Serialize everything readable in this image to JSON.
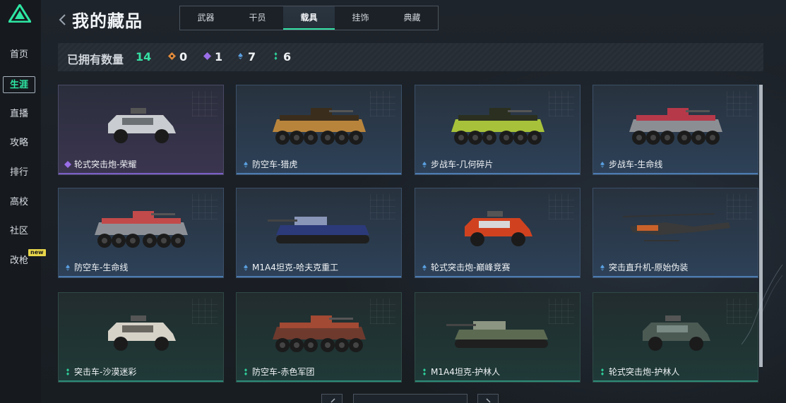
{
  "colors": {
    "accent": "#35e0a4",
    "rarity_orange": "#e08a3a",
    "rarity_purple": "#9a6ee8",
    "rarity_blue": "#5a9fe0",
    "rarity_green": "#2ecf9a"
  },
  "sidebar": {
    "items": [
      {
        "label": "首页"
      },
      {
        "label": "生涯",
        "active": true
      },
      {
        "label": "直播"
      },
      {
        "label": "攻略"
      },
      {
        "label": "排行"
      },
      {
        "label": "高校"
      },
      {
        "label": "社区"
      },
      {
        "label": "改枪",
        "badge": "new"
      }
    ]
  },
  "header": {
    "title": "我的藏品",
    "tabs": [
      {
        "label": "武器"
      },
      {
        "label": "干员"
      },
      {
        "label": "载具",
        "active": true
      },
      {
        "label": "挂饰"
      },
      {
        "label": "典藏"
      }
    ]
  },
  "stats": {
    "owned_label": "已拥有数量",
    "owned_total": "14",
    "rarity_counts": [
      {
        "icon": "orange-diamond-icon",
        "count": "0"
      },
      {
        "icon": "purple-diamond-icon",
        "count": "1"
      },
      {
        "icon": "blue-diamond-icon",
        "count": "7"
      },
      {
        "icon": "green-diamond-icon",
        "count": "6"
      }
    ]
  },
  "items": [
    {
      "name": "轮式突击炮-荣耀",
      "rarity": "purple",
      "icon": "armored-car-icon"
    },
    {
      "name": "防空车-猎虎",
      "rarity": "blue",
      "icon": "apc-icon"
    },
    {
      "name": "步战车-几何碎片",
      "rarity": "blue",
      "icon": "apc-icon"
    },
    {
      "name": "步战车-生命线",
      "rarity": "blue",
      "icon": "apc-icon"
    },
    {
      "name": "防空车-生命线",
      "rarity": "blue",
      "icon": "apc-icon"
    },
    {
      "name": "M1A4坦克-哈夫克重工",
      "rarity": "blue",
      "icon": "tank-icon"
    },
    {
      "name": "轮式突击炮-巅峰竞赛",
      "rarity": "blue",
      "icon": "armored-car-icon"
    },
    {
      "name": "突击直升机-原始伪装",
      "rarity": "blue",
      "icon": "helicopter-icon"
    },
    {
      "name": "突击车-沙漠迷彩",
      "rarity": "green",
      "icon": "armored-car-icon"
    },
    {
      "name": "防空车-赤色军团",
      "rarity": "green",
      "icon": "apc-icon"
    },
    {
      "name": "M1A4坦克-护林人",
      "rarity": "green",
      "icon": "tank-icon"
    },
    {
      "name": "轮式突击炮-护林人",
      "rarity": "green",
      "icon": "armored-car-icon"
    }
  ]
}
